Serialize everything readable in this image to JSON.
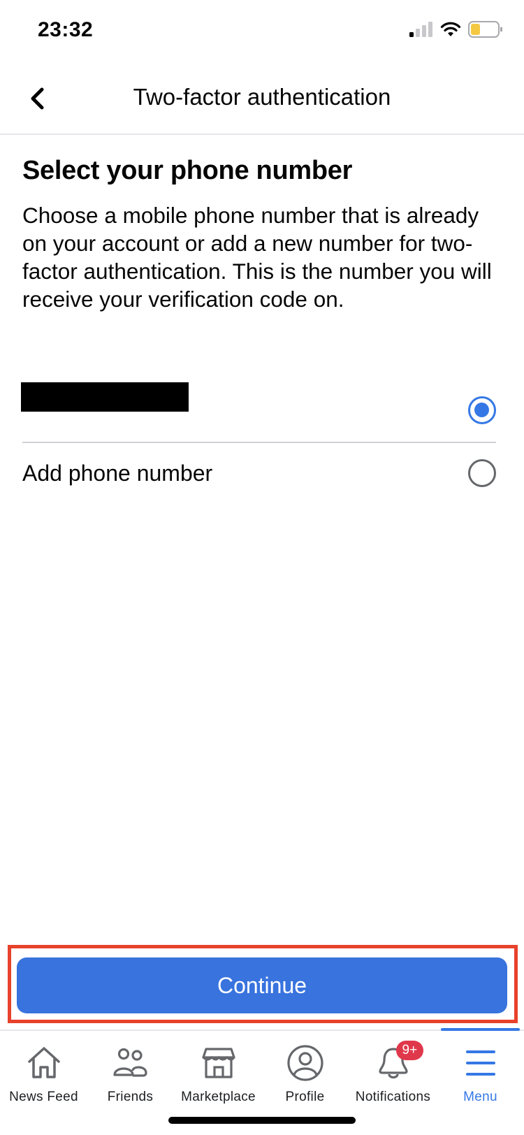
{
  "status_bar": {
    "time": "23:32",
    "signal_icon": "cellular-signal-icon",
    "wifi_icon": "wifi-icon",
    "battery_icon": "battery-low-icon",
    "battery_color": "#f5c842"
  },
  "header": {
    "back_icon": "chevron-left-icon",
    "title": "Two-factor authentication"
  },
  "main": {
    "title": "Select your phone number",
    "description": "Choose a mobile phone number that is already on your account or add a new number for two-factor authentication. This is the number you will receive your verification code on.",
    "options": [
      {
        "label": "[redacted]",
        "selected": true
      },
      {
        "label": "Add phone number",
        "selected": false
      }
    ],
    "continue_label": "Continue",
    "accent_color": "#3578e5",
    "highlight_color": "#e8412c"
  },
  "tab_bar": {
    "items": [
      {
        "label": "News Feed",
        "icon": "home-icon",
        "active": false
      },
      {
        "label": "Friends",
        "icon": "friends-icon",
        "active": false
      },
      {
        "label": "Marketplace",
        "icon": "marketplace-icon",
        "active": false
      },
      {
        "label": "Profile",
        "icon": "profile-icon",
        "active": false
      },
      {
        "label": "Notifications",
        "icon": "bell-icon",
        "active": false,
        "badge": "9+"
      },
      {
        "label": "Menu",
        "icon": "menu-icon",
        "active": true
      }
    ]
  }
}
